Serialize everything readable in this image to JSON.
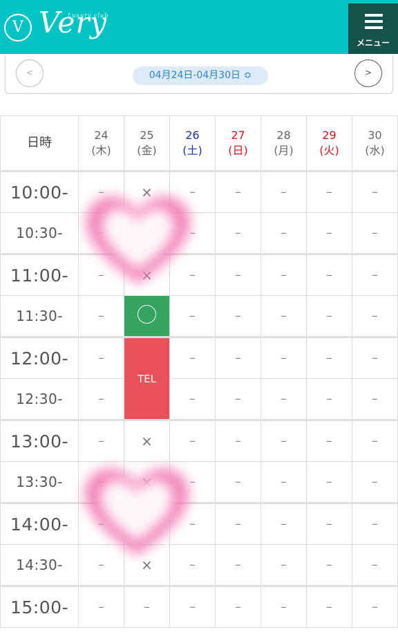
{
  "header": {
    "logo_mark": "V",
    "logo_word": "Very",
    "logo_sub": "Luxury club",
    "menu_label": "メニュー",
    "menu_icon": "hamburger-icon",
    "brand_color": "#00c3c3"
  },
  "week_nav": {
    "prev_label": "<",
    "next_label": ">",
    "range": "04月24日-04月30日 ≎"
  },
  "schedule": {
    "corner_label": "日時",
    "days": [
      {
        "day": "24",
        "weekday": "(木)",
        "type": "weekday"
      },
      {
        "day": "25",
        "weekday": "(金)",
        "type": "weekday"
      },
      {
        "day": "26",
        "weekday": "(土)",
        "type": "sat"
      },
      {
        "day": "27",
        "weekday": "(日)",
        "type": "sun"
      },
      {
        "day": "28",
        "weekday": "(月)",
        "type": "weekday"
      },
      {
        "day": "29",
        "weekday": "(火)",
        "type": "holiday"
      },
      {
        "day": "30",
        "weekday": "(水)",
        "type": "weekday"
      }
    ],
    "rows": [
      {
        "time": "10:00-",
        "slots": [
          "–",
          "×",
          "–",
          "–",
          "–",
          "–",
          "–"
        ]
      },
      {
        "time": "10:30-",
        "slots": [
          "–",
          "×",
          "–",
          "–",
          "–",
          "–",
          "–"
        ]
      },
      {
        "time": "11:00-",
        "slots": [
          "–",
          "×",
          "–",
          "–",
          "–",
          "–",
          "–"
        ]
      },
      {
        "time": "11:30-",
        "slots": [
          "–",
          "◯",
          "–",
          "–",
          "–",
          "–",
          "–"
        ]
      },
      {
        "time": "12:00-",
        "slots": [
          "–",
          "TEL",
          "–",
          "–",
          "–",
          "–",
          "–"
        ]
      },
      {
        "time": "12:30-",
        "slots": [
          "–",
          "TEL",
          "–",
          "–",
          "–",
          "–",
          "–"
        ]
      },
      {
        "time": "13:00-",
        "slots": [
          "–",
          "×",
          "–",
          "–",
          "–",
          "–",
          "–"
        ]
      },
      {
        "time": "13:30-",
        "slots": [
          "–",
          "×",
          "–",
          "–",
          "–",
          "–",
          "–"
        ]
      },
      {
        "time": "14:00-",
        "slots": [
          "–",
          "×",
          "–",
          "–",
          "–",
          "–",
          "–"
        ]
      },
      {
        "time": "14:30-",
        "slots": [
          "–",
          "×",
          "–",
          "–",
          "–",
          "–",
          "–"
        ]
      },
      {
        "time": "15:00-",
        "slots": [
          "–",
          "–",
          "–",
          "–",
          "–",
          "–",
          "–"
        ]
      }
    ],
    "tel_label": "TEL",
    "colors": {
      "open_slot": "#35a460",
      "tel_slot": "#e8525a",
      "saturday": "#1c2fb5",
      "sunday_holiday": "#d8151d"
    }
  }
}
